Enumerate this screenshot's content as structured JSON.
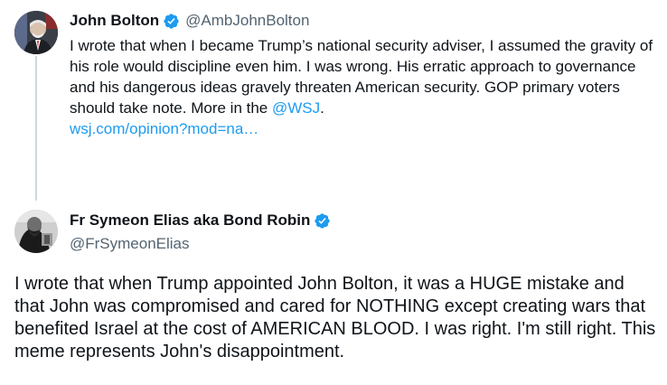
{
  "quoted_tweet": {
    "author_name": "John Bolton",
    "author_handle": "@AmbJohnBolton",
    "text_before_mention": "I wrote that when I became Trump’s national security adviser, I assumed the gravity of his role would discipline even him. I was wrong. His erratic approach to governance and his dangerous ideas gravely threaten American security. GOP primary voters should take note. More in the ",
    "mention": "@WSJ",
    "text_after_mention": ".",
    "link": "wsj.com/opinion?mod=na…",
    "verified_icon": "verified-badge-icon",
    "avatar": "avatar-photo"
  },
  "main_tweet": {
    "author_name": "Fr Symeon Elias aka Bond Robin",
    "author_handle": "@FrSymeonElias",
    "text": "I wrote that when Trump appointed John Bolton, it was a HUGE mistake and that John was compromised and cared for NOTHING except creating wars that benefited Israel at the cost of AMERICAN BLOOD. I was right. I'm still right. This meme represents John's disappointment.",
    "verified_icon": "verified-badge-icon",
    "avatar": "avatar-photo"
  },
  "colors": {
    "text": "#0f1419",
    "secondary": "#536471",
    "link": "#1d9bf0",
    "verified": "#1d9bf0",
    "thread_line": "#cfd9de"
  }
}
